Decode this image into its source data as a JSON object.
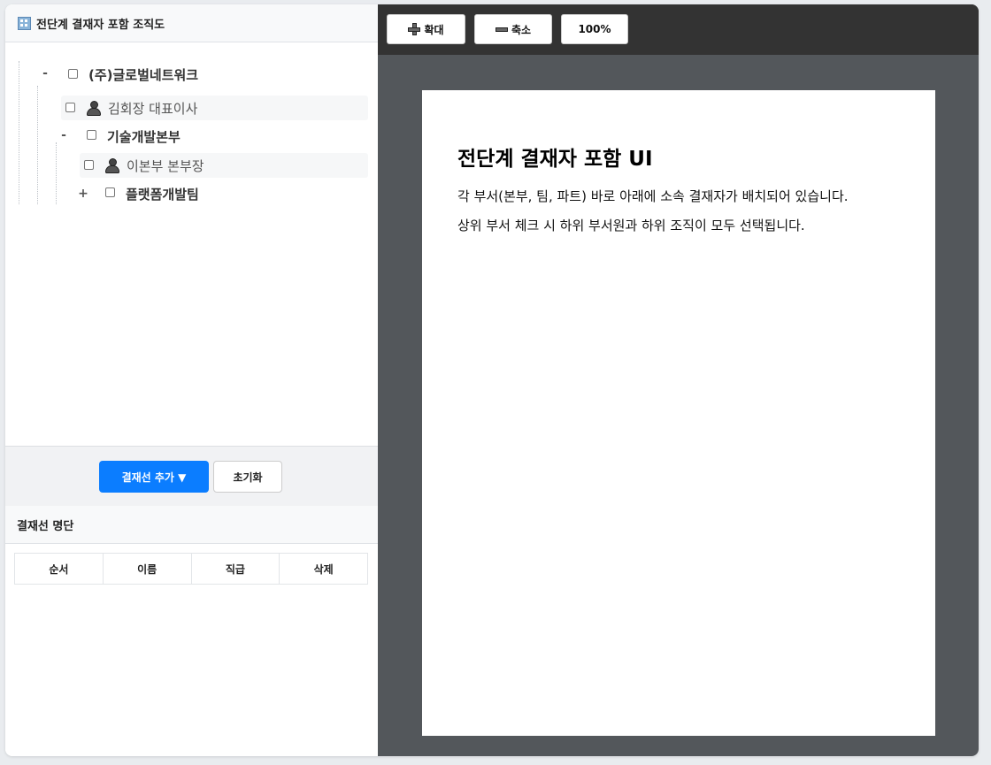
{
  "org_panel": {
    "title": "전단계 결재자 포함 조직도",
    "icon": "building-icon"
  },
  "tree": {
    "root": {
      "toggle": "-",
      "label": "(주)글로벌네트워크"
    },
    "root_member": {
      "label": "김회장 대표이사",
      "icon": "person-icon"
    },
    "dept1": {
      "toggle": "-",
      "label": "기술개발본부"
    },
    "dept1_member": {
      "label": "이본부 본부장",
      "icon": "person-icon"
    },
    "dept1_sub": {
      "toggle": "+",
      "label": "플랫폼개발팀"
    }
  },
  "actions": {
    "add_label": "결재선 추가 ▼",
    "reset_label": "초기화",
    "accent": "#0b7dff"
  },
  "approver_list": {
    "title": "결재선 명단",
    "columns": [
      "순서",
      "이름",
      "직급",
      "삭제"
    ],
    "rows": []
  },
  "viewer": {
    "toolbar": {
      "zoom_in_label": "확대",
      "zoom_out_label": "축소",
      "zoom_level": "100%"
    },
    "document": {
      "heading": "전단계 결재자 포함 UI",
      "paragraphs": [
        "각 부서(본부, 팀, 파트) 바로 아래에 소속 결재자가 배치되어 있습니다.",
        "상위 부서 체크 시 하위 부서원과 하위 조직이 모두 선택됩니다."
      ]
    }
  }
}
